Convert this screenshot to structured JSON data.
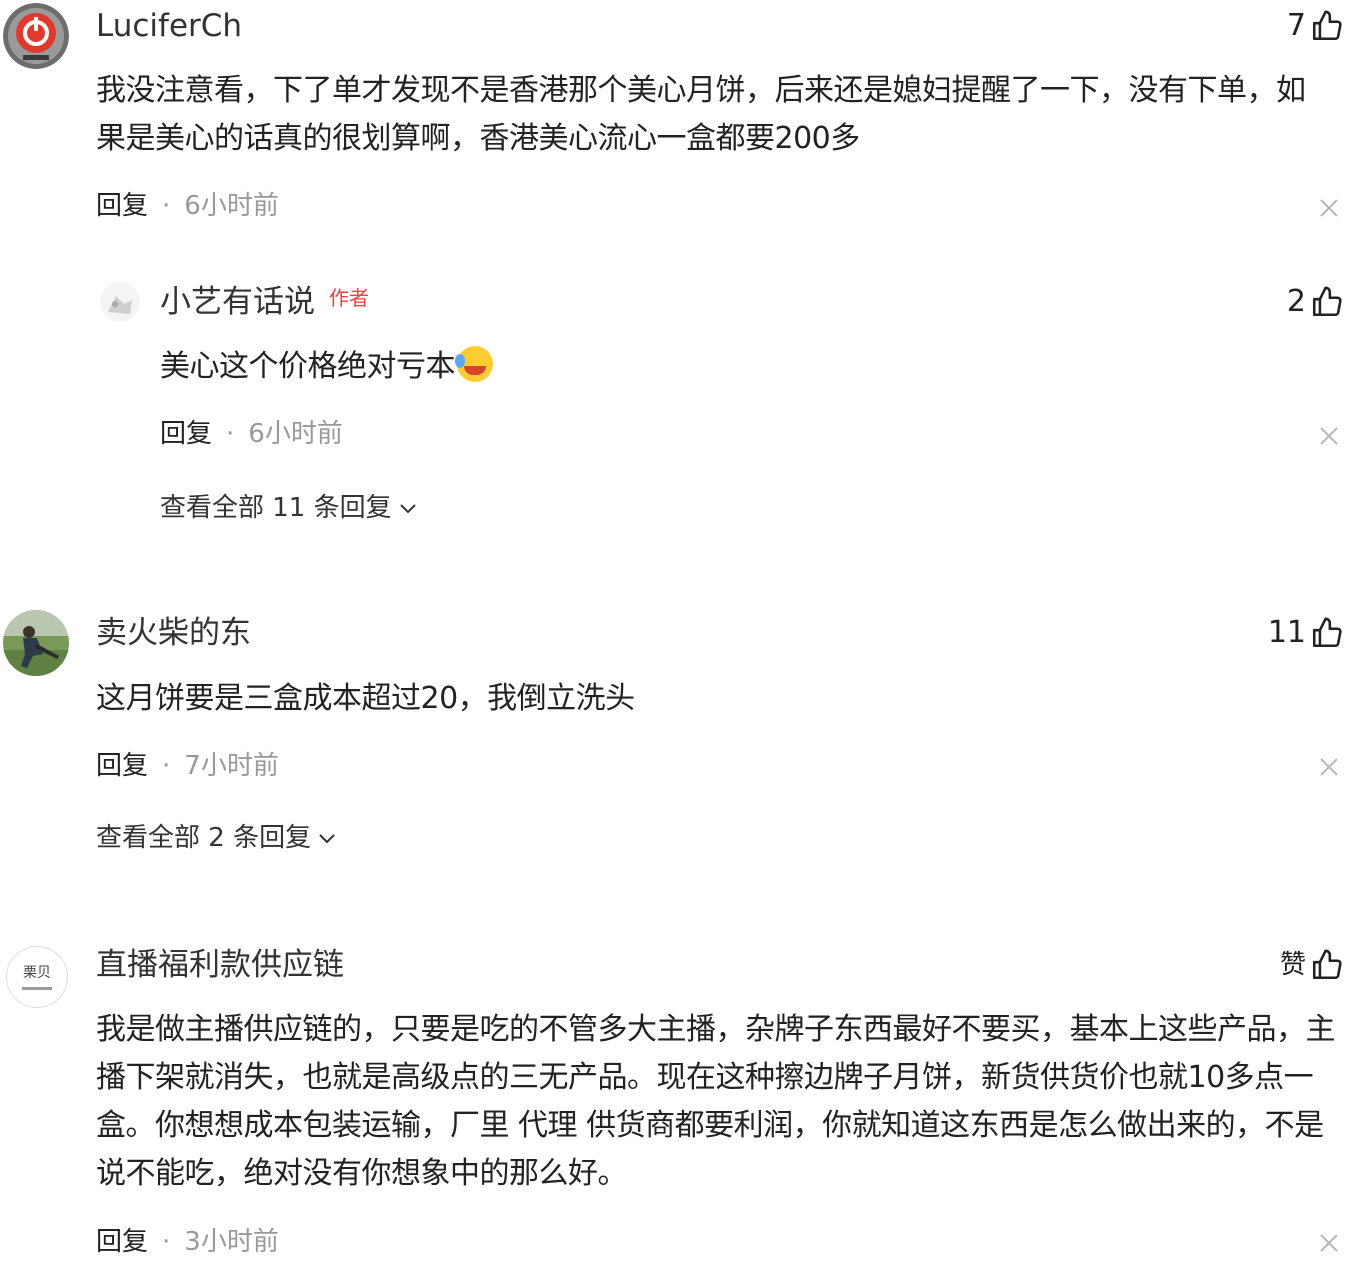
{
  "icons": {
    "like": "thumbs-up-icon",
    "close": "close-icon",
    "expand": "chevron-down-icon"
  },
  "colors": {
    "author_badge": "#f04142",
    "meta_gray": "#999999"
  },
  "comments": [
    {
      "username": "LuciferCh",
      "likes": "7",
      "text": "我没注意看，下了单才发现不是香港那个美心月饼，后来还是媳妇提醒了一下，没有下单，如果是美心的话真的很划算啊，香港美心流心一盒都要200多",
      "reply_label": "回复",
      "separator": "·",
      "time": "6小时前",
      "reply": {
        "username": "小艺有话说",
        "badge": "作者",
        "likes": "2",
        "text": "美心这个价格绝对亏本",
        "reply_label": "回复",
        "separator": "·",
        "time": "6小时前"
      },
      "view_all": "查看全部 11 条回复"
    },
    {
      "username": "卖火柴的东",
      "likes": "11",
      "text": "这月饼要是三盒成本超过20，我倒立洗头",
      "reply_label": "回复",
      "separator": "·",
      "time": "7小时前",
      "view_all": "查看全部 2 条回复"
    },
    {
      "username": "直播福利款供应链",
      "likes": "赞",
      "avatar_text": "栗贝",
      "text": "我是做主播供应链的，只要是吃的不管多大主播，杂牌子东西最好不要买，基本上这些产品，主播下架就消失，也就是高级点的三无产品。现在这种擦边牌子月饼，新货供货价也就10多点一盒。你想想成本包装运输，厂里 代理 供货商都要利润，你就知道这东西是怎么做出来的，不是说不能吃，绝对没有你想象中的那么好。",
      "reply_label": "回复",
      "separator": "·",
      "time": "3小时前"
    }
  ]
}
